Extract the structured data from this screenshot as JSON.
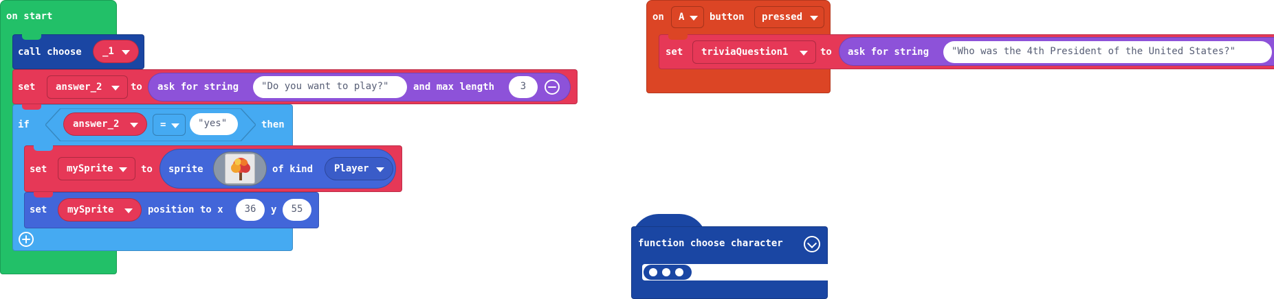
{
  "on_start": {
    "label": "on start",
    "call": {
      "label": "call choose",
      "arg": "_1"
    },
    "set_answer": {
      "set": "set",
      "variable": "answer_2",
      "to": "to",
      "ask": "ask for string",
      "prompt": "Do you want to play?",
      "max_label": "and max length",
      "max_value": "3"
    },
    "if_block": {
      "if": "if",
      "variable": "answer_2",
      "operator": "=",
      "compare": "yes",
      "then": "then",
      "set_sprite": {
        "set": "set",
        "variable": "mySprite",
        "to": "to",
        "sprite": "sprite",
        "of_kind": "of kind",
        "kind": "Player"
      },
      "set_position": {
        "set": "set",
        "variable": "mySprite",
        "position_to": "position to x",
        "x": "36",
        "y_label": "y",
        "y": "55"
      }
    }
  },
  "on_button": {
    "on": "on",
    "button_key": "A",
    "button_label": "button",
    "event": "pressed",
    "set_trivia": {
      "set": "set",
      "variable": "triviaQuestion1",
      "to": "to",
      "ask": "ask for string",
      "prompt": "Who was the 4th President of the United States?"
    }
  },
  "function_block": {
    "label": "function choose character"
  },
  "quote": "\""
}
